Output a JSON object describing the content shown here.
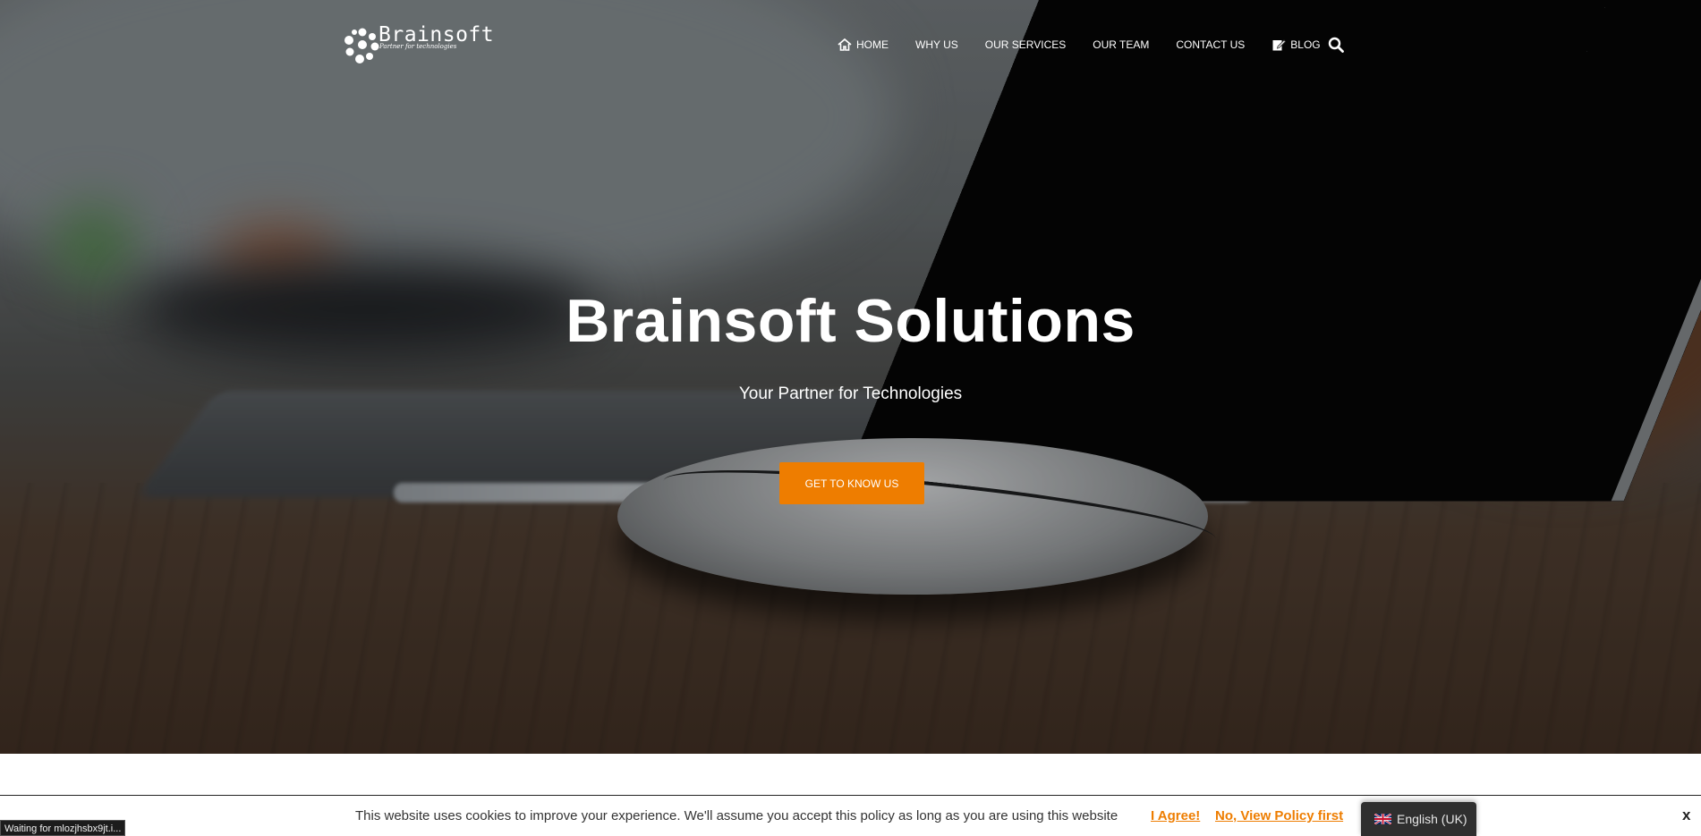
{
  "logo": {
    "name": "Brainsoft",
    "tagline": "Partner for technologies"
  },
  "nav": {
    "items": [
      {
        "label": "HOME",
        "icon": "home-icon"
      },
      {
        "label": "WHY US"
      },
      {
        "label": "OUR SERVICES"
      },
      {
        "label": "OUR TEAM"
      },
      {
        "label": "CONTACT US"
      },
      {
        "label": "BLOG",
        "icon": "edit-icon"
      }
    ],
    "search_icon": "search-icon"
  },
  "hero": {
    "title": "Brainsoft Solutions",
    "subtitle": "Your Partner for Technologies",
    "cta_label": "GET TO KNOW US"
  },
  "cookie_bar": {
    "message": "This website uses cookies to improve your experience. We'll assume you accept this policy as long as you are using this website",
    "agree_label": "I Agree!",
    "policy_label": "No, View Policy first",
    "close_label": "x"
  },
  "language": {
    "label": "English (UK)",
    "flag_icon": "uk-flag-icon"
  },
  "status_bar": {
    "text": "Waiting for mlozjhsbx9jt.i..."
  },
  "colors": {
    "accent": "#ee7d00",
    "cookie_link": "#ee7d00"
  }
}
